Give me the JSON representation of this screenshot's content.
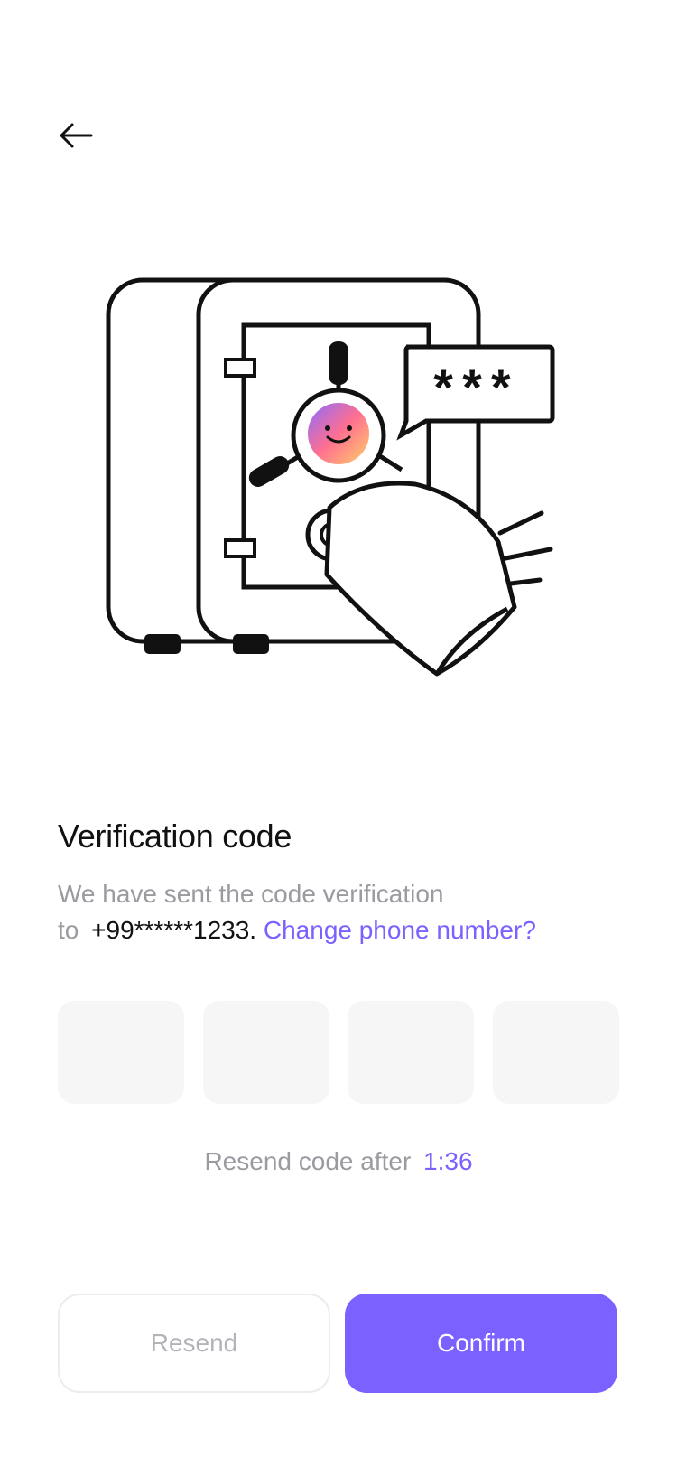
{
  "header": {
    "back_icon": "arrow-left-icon"
  },
  "illustration": {
    "icon": "safe-with-hand-icon",
    "password_mask": "***",
    "accent_colors": [
      "#8a6cff",
      "#ff6f91",
      "#ffd166"
    ]
  },
  "verification": {
    "title": "Verification code",
    "subtitle_line1": "We have sent the code verification",
    "subtitle_to": "to",
    "phone": "+99******1233.",
    "change_link": "Change phone number?"
  },
  "code_inputs": [
    {
      "value": ""
    },
    {
      "value": ""
    },
    {
      "value": ""
    },
    {
      "value": ""
    }
  ],
  "resend_timer": {
    "label": "Resend code after",
    "time": "1:36"
  },
  "actions": {
    "resend_label": "Resend",
    "confirm_label": "Confirm"
  },
  "colors": {
    "accent": "#7b61ff",
    "muted_text": "#9a9aa0",
    "input_bg": "#f6f6f7"
  }
}
